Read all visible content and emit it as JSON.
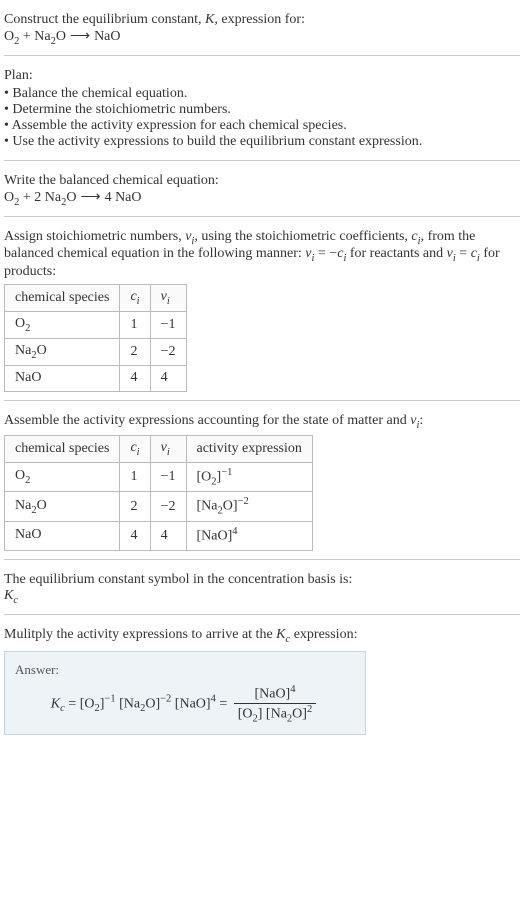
{
  "intro": {
    "prompt": "Construct the equilibrium constant, ",
    "K": "K",
    "prompt2": ", expression for:"
  },
  "eq_unbalanced": {
    "O2": "O",
    "sub2": "2",
    "plus": " + ",
    "Na2O_Na": "Na",
    "Na2O_sub": "2",
    "Na2O_O": "O",
    "arrow": " ⟶ ",
    "NaO": "NaO"
  },
  "plan": {
    "heading": "Plan:",
    "items": [
      "Balance the chemical equation.",
      "Determine the stoichiometric numbers.",
      "Assemble the activity expression for each chemical species.",
      "Use the activity expressions to build the equilibrium constant expression."
    ]
  },
  "balanced": {
    "heading": "Write the balanced chemical equation:",
    "O2": "O",
    "sub2a": "2",
    "plus": " + 2 ",
    "Na2O_Na": "Na",
    "Na2O_sub": "2",
    "Na2O_O": "O",
    "arrow": " ⟶ ",
    "four": "4 ",
    "NaO": "NaO"
  },
  "assign": {
    "text1": "Assign stoichiometric numbers, ",
    "nu": "ν",
    "sub_i": "i",
    "text2": ", using the stoichiometric coefficients, ",
    "c": "c",
    "text3": ", from the balanced chemical equation in the following manner: ",
    "text4": " = −",
    "text5": " for reactants and ",
    "text6": " = ",
    "text7": " for products:",
    "headers": {
      "species": "chemical species",
      "ci": "c",
      "ci_sub": "i",
      "nui": "ν",
      "nui_sub": "i"
    },
    "rows": [
      {
        "species_main": "O",
        "species_sub": "2",
        "species_tail": "",
        "ci": "1",
        "nui": "−1"
      },
      {
        "species_main": "Na",
        "species_sub": "2",
        "species_tail": "O",
        "ci": "2",
        "nui": "−2"
      },
      {
        "species_main": "NaO",
        "species_sub": "",
        "species_tail": "",
        "ci": "4",
        "nui": "4"
      }
    ]
  },
  "assemble": {
    "text1": "Assemble the activity expressions accounting for the state of matter and ",
    "nu": "ν",
    "sub_i": "i",
    "colon": ":",
    "headers": {
      "species": "chemical species",
      "ci": "c",
      "ci_sub": "i",
      "nui": "ν",
      "nui_sub": "i",
      "activity": "activity expression"
    },
    "rows": [
      {
        "species_main": "O",
        "species_sub": "2",
        "species_tail": "",
        "ci": "1",
        "nui": "−1",
        "act_text": "[O",
        "act_sub": "2",
        "act_close": "]",
        "act_sup": "−1"
      },
      {
        "species_main": "Na",
        "species_sub": "2",
        "species_tail": "O",
        "ci": "2",
        "nui": "−2",
        "act_text": "[Na",
        "act_sub": "2",
        "act_close": "O]",
        "act_sup": "−2"
      },
      {
        "species_main": "NaO",
        "species_sub": "",
        "species_tail": "",
        "ci": "4",
        "nui": "4",
        "act_text": "[NaO]",
        "act_sub": "",
        "act_close": "",
        "act_sup": "4"
      }
    ]
  },
  "symbol": {
    "text": "The equilibrium constant symbol in the concentration basis is:",
    "K": "K",
    "sub": "c"
  },
  "multiply": {
    "text1": "Mulitply the activity expressions to arrive at the ",
    "K": "K",
    "sub": "c",
    "text2": " expression:"
  },
  "answer": {
    "label": "Answer:",
    "Kc_K": "K",
    "Kc_sub": "c",
    "eq": " = ",
    "t1": "[O",
    "t1sub": "2",
    "t1close": "]",
    "t1sup": "−1",
    "sp": " ",
    "t2": "[Na",
    "t2sub": "2",
    "t2close": "O]",
    "t2sup": "−2",
    "t3": "[NaO]",
    "t3sup": "4",
    "eq2": " = ",
    "num1": "[NaO]",
    "num1sup": "4",
    "den1": "[O",
    "den1sub": "2",
    "den1close": "] ",
    "den2": "[Na",
    "den2sub": "2",
    "den2close": "O]",
    "den2sup": "2"
  }
}
